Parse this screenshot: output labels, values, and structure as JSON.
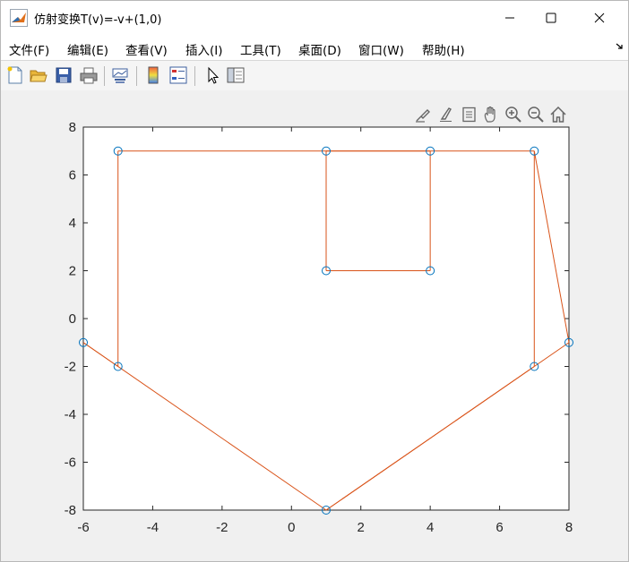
{
  "window": {
    "title": "仿射变换T(v)=-v+(1,0)",
    "controls": [
      "minimize",
      "maximize",
      "close"
    ]
  },
  "menu": [
    {
      "label": "文件(F)"
    },
    {
      "label": "编辑(E)"
    },
    {
      "label": "查看(V)"
    },
    {
      "label": "插入(I)"
    },
    {
      "label": "工具(T)"
    },
    {
      "label": "桌面(D)"
    },
    {
      "label": "窗口(W)"
    },
    {
      "label": "帮助(H)"
    }
  ],
  "toolbar": [
    "new-figure-icon",
    "open-icon",
    "save-icon",
    "print-icon",
    "link-plot-icon",
    "insert-colorbar-icon",
    "insert-legend-icon",
    "pointer-icon",
    "property-inspector-icon"
  ],
  "axes_toolbar": [
    "brush-icon",
    "data-cursor-icon",
    "restore-view-icon",
    "pan-icon",
    "zoom-in-icon",
    "zoom-out-icon",
    "home-icon"
  ],
  "colors": {
    "line": "#d95319",
    "marker": "#0072bd",
    "axis": "#262626"
  },
  "chart_data": {
    "type": "line",
    "title": "",
    "xlabel": "",
    "ylabel": "",
    "xlim": [
      -6,
      8
    ],
    "ylim": [
      -8,
      8
    ],
    "xticks": [
      -6,
      -4,
      -2,
      0,
      2,
      4,
      6,
      8
    ],
    "yticks": [
      -8,
      -6,
      -4,
      -2,
      0,
      2,
      4,
      6,
      8
    ],
    "xtick_labels": [
      "-6",
      "-4",
      "-2",
      "0",
      "2",
      "4",
      "6",
      "8"
    ],
    "ytick_labels": [
      "-8",
      "-6",
      "-4",
      "-2",
      "0",
      "2",
      "4",
      "6",
      "8"
    ],
    "grid": false,
    "box": true,
    "series": [
      {
        "style": "line",
        "color": "#d95319",
        "x": [
          1,
          7,
          7,
          8,
          1,
          -6,
          -5,
          -5,
          1,
          1,
          4,
          4,
          1,
          4,
          4,
          7
        ],
        "y": [
          -8,
          -2,
          7,
          -1,
          -8,
          -1,
          -2,
          7,
          7,
          2,
          2,
          7,
          7,
          7,
          7,
          7
        ]
      },
      {
        "style": "marker",
        "marker": "o",
        "color": "#0072bd",
        "x": [
          1,
          7,
          7,
          8,
          -6,
          -5,
          -5,
          1,
          1,
          4,
          4
        ],
        "y": [
          -8,
          -2,
          7,
          -1,
          -1,
          -2,
          7,
          7,
          2,
          2,
          7
        ]
      }
    ]
  }
}
